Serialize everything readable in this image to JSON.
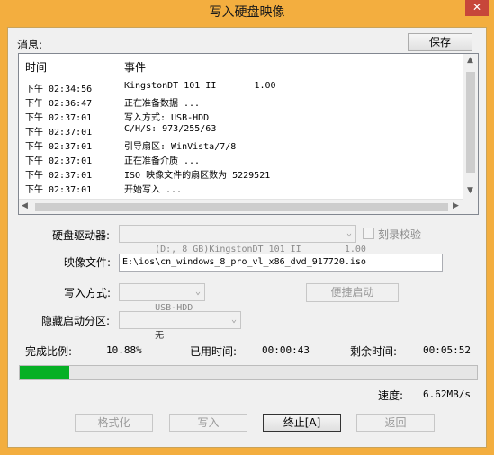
{
  "window": {
    "title": "写入硬盘映像",
    "close": "✕"
  },
  "messages": {
    "label": "消息:",
    "save_button": "保存",
    "columns": {
      "time": "时间",
      "event": "事件"
    },
    "rows": [
      {
        "time": "下午 02:34:56",
        "event": "KingstonDT 101 II       1.00"
      },
      {
        "time": "下午 02:36:47",
        "event": "正在准备数据 ..."
      },
      {
        "time": "下午 02:37:01",
        "event": "写入方式: USB-HDD"
      },
      {
        "time": "下午 02:37:01",
        "event": "C/H/S: 973/255/63"
      },
      {
        "time": "下午 02:37:01",
        "event": "引导扇区: WinVista/7/8"
      },
      {
        "time": "下午 02:37:01",
        "event": "正在准备介质 ..."
      },
      {
        "time": "下午 02:37:01",
        "event": "ISO 映像文件的扇区数为 5229521"
      },
      {
        "time": "下午 02:37:01",
        "event": "开始写入 ..."
      }
    ]
  },
  "form": {
    "drive_label": "硬盘驱动器:",
    "drive_value": "(D:, 8 GB)KingstonDT 101 II        1.00",
    "verify_label": "刻录校验",
    "image_label": "映像文件:",
    "image_value": "E:\\ios\\cn_windows_8_pro_vl_x86_dvd_917720.iso",
    "write_method_label": "写入方式:",
    "write_method_value": "USB-HDD",
    "quick_boot_button": "便捷启动",
    "hidden_partition_label": "隐藏启动分区:",
    "hidden_partition_value": "无"
  },
  "progress": {
    "completed_label": "完成比例:",
    "completed_value": "10.88%",
    "completed_fraction": 0.1088,
    "elapsed_label": "已用时间:",
    "elapsed_value": "00:00:43",
    "remaining_label": "剩余时间:",
    "remaining_value": "00:05:52",
    "speed_label": "速度:",
    "speed_value": "6.62MB/s"
  },
  "buttons": {
    "format": "格式化",
    "write": "写入",
    "abort": "终止[A]",
    "back": "返回"
  },
  "colors": {
    "titlebar": "#f3ae3f",
    "progress_fill": "#06b025",
    "close": "#c7463a"
  }
}
